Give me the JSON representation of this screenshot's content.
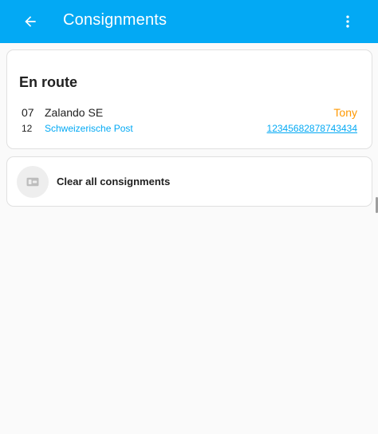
{
  "app_bar": {
    "title": "Consignments",
    "color": "#03a9f4",
    "back_icon": "arrow-left-icon",
    "menu_icon": "dots-vertical-icon"
  },
  "en_route": {
    "title": "En route",
    "items": [
      {
        "day": "07",
        "month": "12",
        "name": "Zalando SE",
        "carrier": "Schweizerische Post",
        "recipient": "Tony",
        "tracking": "12345682878743434"
      }
    ]
  },
  "actions": {
    "clear_all_label": "Clear all consignments",
    "clear_icon": "package-delete-icon"
  },
  "colors": {
    "accent": "#03a9f4",
    "recipient": "#ff9800",
    "background": "#fafafa"
  }
}
